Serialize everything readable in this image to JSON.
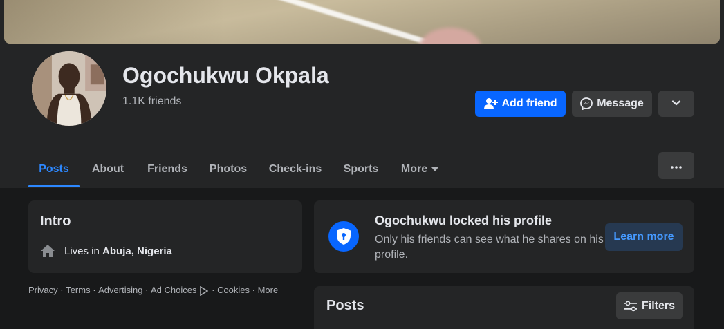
{
  "profile": {
    "name": "Ogochukwu Okpala",
    "friends_count": "1.1K friends"
  },
  "actions": {
    "add_friend": "Add friend",
    "message": "Message"
  },
  "tabs": [
    {
      "label": "Posts",
      "active": true
    },
    {
      "label": "About"
    },
    {
      "label": "Friends"
    },
    {
      "label": "Photos"
    },
    {
      "label": "Check-ins"
    },
    {
      "label": "Sports"
    },
    {
      "label": "More"
    }
  ],
  "intro": {
    "title": "Intro",
    "lives_prefix": "Lives in ",
    "location": "Abuja, Nigeria"
  },
  "footer": {
    "privacy": "Privacy",
    "terms": "Terms",
    "advertising": "Advertising",
    "ad_choices": "Ad Choices",
    "cookies": "Cookies",
    "more": "More",
    "separator": " · "
  },
  "locked": {
    "title": "Ogochukwu locked his profile",
    "description": "Only his friends can see what he shares on his profile.",
    "learn_more": "Learn more"
  },
  "posts": {
    "title": "Posts",
    "filters": "Filters"
  },
  "colors": {
    "accent": "#0866ff",
    "link": "#2d88ff",
    "background": "#18191a",
    "surface": "#242526",
    "button": "#3a3b3c"
  },
  "icons": {
    "add_friend": "person-plus-icon",
    "message": "messenger-icon",
    "dropdown": "chevron-down-icon",
    "more_tab": "caret-down-icon",
    "dots": "ellipsis-icon",
    "home": "home-icon",
    "lock": "shield-lock-icon",
    "ad_choices": "ad-choices-icon",
    "filters": "sliders-icon"
  }
}
